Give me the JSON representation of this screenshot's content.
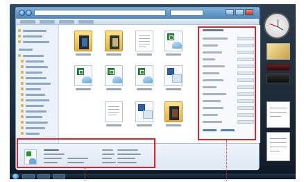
{
  "colors": {
    "callout": "#e0202a",
    "titlebar": "#4f86b8",
    "folder": "#e5b23a",
    "excel": "#2e8f3c",
    "powerpoint": "#2c5fa8"
  },
  "explorer": {
    "icons": [
      "back-icon",
      "forward-icon",
      "minimize-icon",
      "maximize-icon",
      "close-icon"
    ]
  },
  "files": [
    {
      "kind": "folder"
    },
    {
      "kind": "folder"
    },
    {
      "kind": "document"
    },
    {
      "kind": "spreadsheet"
    },
    {
      "kind": "spreadsheet"
    },
    {
      "kind": "spreadsheet"
    },
    {
      "kind": "spreadsheet"
    },
    {
      "kind": "presentation"
    },
    {
      "kind": "document"
    },
    {
      "kind": "presentation"
    },
    {
      "kind": "folder"
    }
  ],
  "callouts": [
    {
      "target": "preview-pane"
    },
    {
      "target": "details-pane"
    }
  ],
  "gadgets": [
    "clock",
    "slideshow",
    "feed",
    "feed",
    "notes",
    "notes"
  ]
}
